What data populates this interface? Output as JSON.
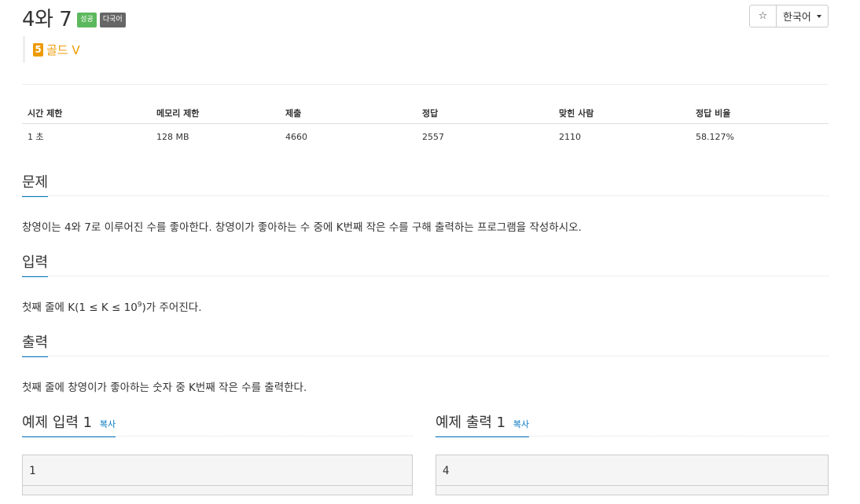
{
  "problem": {
    "title": "4와 7",
    "badges": [
      "성공",
      "다국어"
    ],
    "tier": {
      "level": "5",
      "name": "골드 V"
    }
  },
  "toolbar": {
    "star": "☆",
    "language": "한국어"
  },
  "info_table": {
    "headers": [
      "시간 제한",
      "메모리 제한",
      "제출",
      "정답",
      "맞힌 사람",
      "정답 비율"
    ],
    "values": [
      "1 초",
      "128 MB",
      "4660",
      "2557",
      "2110",
      "58.127%"
    ]
  },
  "sections": {
    "problem": {
      "title": "문제",
      "text": "창영이는 4와 7로 이루어진 수를 좋아한다. 창영이가 좋아하는 수 중에 K번째 작은 수를 구해 출력하는 프로그램을 작성하시오."
    },
    "input": {
      "title": "입력",
      "text_before": "첫째 줄에 K(1 ≤ K ≤ 10",
      "sup": "9",
      "text_after": ")가 주어진다."
    },
    "output": {
      "title": "출력",
      "text": "첫째 줄에 창영이가 좋아하는 숫자 중 K번째 작은 수를 출력한다."
    }
  },
  "samples": {
    "input": {
      "title": "예제 입력 1",
      "copy": "복사",
      "value": "1"
    },
    "output": {
      "title": "예제 출력 1",
      "copy": "복사",
      "value": "4"
    }
  },
  "colors": {
    "success": "#5cb85c",
    "gold": "#ec9a00",
    "accent": "#0076c0"
  }
}
